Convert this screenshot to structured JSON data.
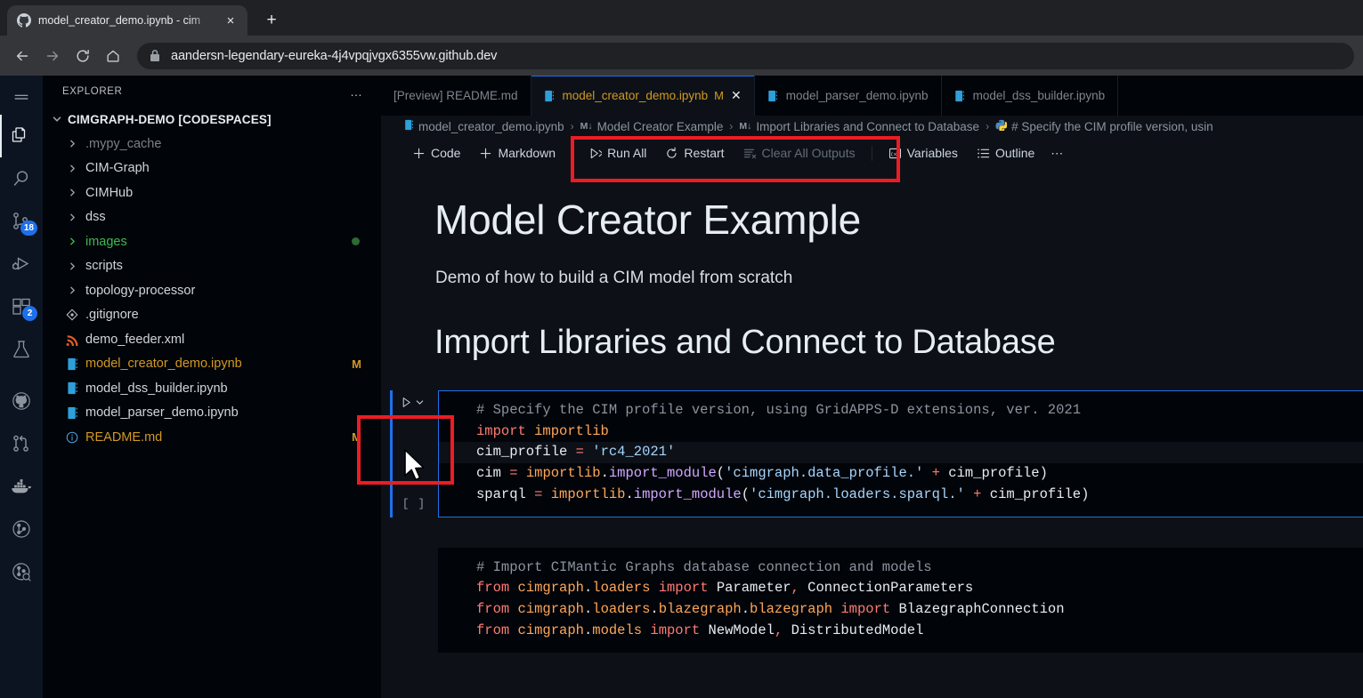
{
  "browser": {
    "tab": {
      "title": "model_creator_demo.ipynb - cim",
      "favicon": "github-icon",
      "close": "×"
    },
    "newtab_label": "+",
    "nav": {
      "back": "←",
      "forward": "→",
      "reload": "⟳",
      "home": "⌂"
    },
    "url": "aandersn-legendary-eureka-4j4vpqjvgx6355vw.github.dev"
  },
  "activitybar": {
    "items": [
      {
        "name": "menu-icon",
        "badge": null
      },
      {
        "name": "explorer-icon",
        "badge": null
      },
      {
        "name": "search-icon",
        "badge": null
      },
      {
        "name": "source-control-icon",
        "badge": "18"
      },
      {
        "name": "run-and-debug-icon",
        "badge": null
      },
      {
        "name": "extensions-icon",
        "badge": "2"
      },
      {
        "name": "testing-icon",
        "badge": null
      },
      {
        "name": "github-icon",
        "badge": null
      },
      {
        "name": "pull-request-icon",
        "badge": null
      },
      {
        "name": "docker-icon",
        "badge": null
      },
      {
        "name": "gitlens-icon",
        "badge": null
      },
      {
        "name": "gitlens-inspect-icon",
        "badge": null
      }
    ]
  },
  "sidebar": {
    "title": "EXPLORER",
    "more_label": "…",
    "root": "CIMGRAPH-DEMO [CODESPACES]",
    "items": [
      {
        "label": ".mypy_cache",
        "type": "folder",
        "state": "dim",
        "badge": "",
        "dot": false
      },
      {
        "label": "CIM-Graph",
        "type": "folder",
        "state": "normal",
        "badge": "",
        "dot": false
      },
      {
        "label": "CIMHub",
        "type": "folder",
        "state": "normal",
        "badge": "",
        "dot": false
      },
      {
        "label": "dss",
        "type": "folder",
        "state": "normal",
        "badge": "",
        "dot": false
      },
      {
        "label": "images",
        "type": "folder",
        "state": "green",
        "badge": "",
        "dot": true
      },
      {
        "label": "scripts",
        "type": "folder",
        "state": "normal",
        "badge": "",
        "dot": false
      },
      {
        "label": "topology-processor",
        "type": "folder",
        "state": "normal",
        "badge": "",
        "dot": false
      },
      {
        "label": ".gitignore",
        "type": "git-file",
        "state": "normal",
        "badge": "",
        "dot": false
      },
      {
        "label": "demo_feeder.xml",
        "type": "xml-file",
        "state": "normal",
        "badge": "",
        "dot": false
      },
      {
        "label": "model_creator_demo.ipynb",
        "type": "notebook-file",
        "state": "modified",
        "badge": "M",
        "dot": false
      },
      {
        "label": "model_dss_builder.ipynb",
        "type": "notebook-file",
        "state": "normal",
        "badge": "",
        "dot": false
      },
      {
        "label": "model_parser_demo.ipynb",
        "type": "notebook-file",
        "state": "normal",
        "badge": "",
        "dot": false
      },
      {
        "label": "README.md",
        "type": "info-file",
        "state": "modified",
        "badge": "M",
        "dot": false
      }
    ]
  },
  "editor": {
    "tabs": [
      {
        "label": "[Preview] README.md",
        "icon": null,
        "active": false,
        "dirty": "",
        "close": ""
      },
      {
        "label": "model_creator_demo.ipynb",
        "icon": "notebook-icon",
        "active": true,
        "dirty": "M",
        "close": "✕"
      },
      {
        "label": "model_parser_demo.ipynb",
        "icon": "notebook-icon",
        "active": false,
        "dirty": "",
        "close": ""
      },
      {
        "label": "model_dss_builder.ipynb",
        "icon": "notebook-icon",
        "active": false,
        "dirty": "",
        "close": ""
      }
    ],
    "breadcrumb": {
      "file": "model_creator_demo.ipynb",
      "sep": "›",
      "md_glyph": "M↓",
      "crumb1": "Model Creator Example",
      "crumb2": "Import Libraries and Connect to Database",
      "crumb3": "# Specify the CIM profile version, usin"
    },
    "toolbar": {
      "code": "Code",
      "markdown": "Markdown",
      "run_all": "Run All",
      "restart": "Restart",
      "clear_outputs": "Clear All Outputs",
      "variables": "Variables",
      "outline": "Outline",
      "more": "⋯",
      "plus": "+"
    }
  },
  "notebook": {
    "h1": "Model Creator Example",
    "intro": "Demo of how to build a CIM model from scratch",
    "h2": "Import Libraries and Connect to Database",
    "cell1": {
      "exec_count": "[ ]",
      "lines": [
        "# Specify the CIM profile version, using GridAPPS-D extensions, ver. 2021",
        "import importlib",
        "cim_profile = 'rc4_2021'",
        "cim = importlib.import_module('cimgraph.data_profile.' + cim_profile)",
        "sparql = importlib.import_module('cimgraph.loaders.sparql.' + cim_profile)"
      ]
    },
    "cell2": {
      "lines": [
        "# Import CIMantic Graphs database connection and models",
        "from cimgraph.loaders import Parameter, ConnectionParameters",
        "from cimgraph.loaders.blazegraph.blazegraph import BlazegraphConnection",
        "from cimgraph.models import NewModel, DistributedModel"
      ]
    }
  },
  "annotations": {
    "color": "#ec1c24",
    "boxes": [
      {
        "name": "toolbar-highlight"
      },
      {
        "name": "run-cell-highlight"
      }
    ]
  }
}
